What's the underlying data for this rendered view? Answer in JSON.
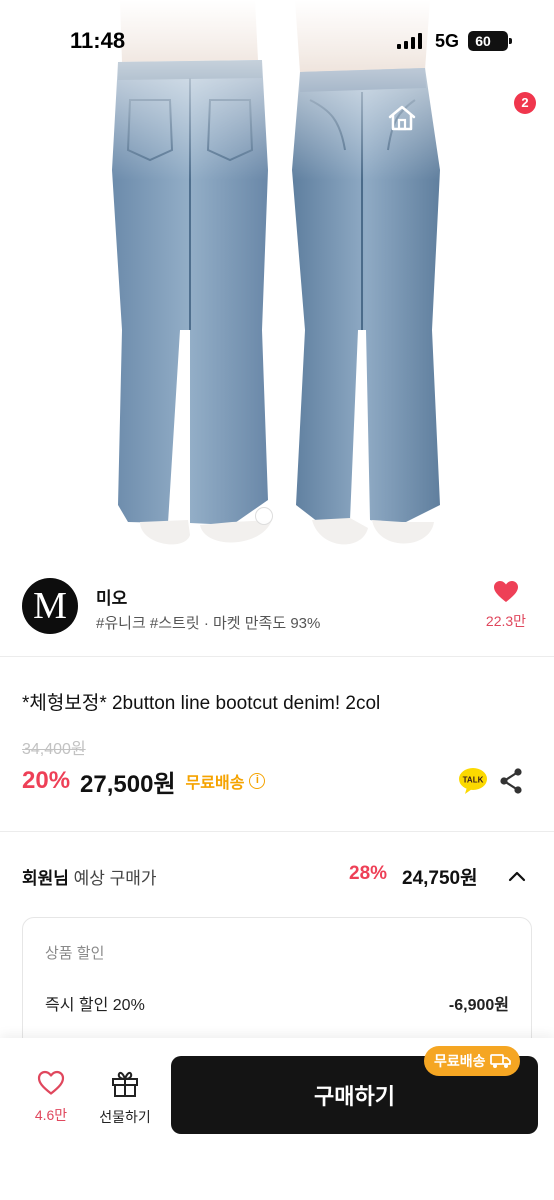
{
  "status_bar": {
    "time": "11:48",
    "network": "5G",
    "battery": "60"
  },
  "nav": {
    "cart_count": "2"
  },
  "seller": {
    "logo_letter": "M",
    "name": "미오",
    "tags": "#유니크 #스트릿 · 마켓 만족도 93%",
    "likes": "22.3만"
  },
  "product": {
    "title": "*체형보정* 2button line bootcut denim! 2col",
    "original_price": "34,400원",
    "discount_rate": "20%",
    "sale_price": "27,500원",
    "free_shipping": "무료배송",
    "info_icon": "i"
  },
  "member": {
    "label_bold": "회원님",
    "label_rest": " 예상 구매가",
    "rate": "28%",
    "price": "24,750원"
  },
  "discount_box": {
    "heading": "상품 할인",
    "item_label": "즉시 할인 20%",
    "item_value": "-6,900원"
  },
  "bottom_bar": {
    "wish_count": "4.6만",
    "gift_label": "선물하기",
    "buy_label": "구매하기",
    "ship_badge": "무료배송"
  },
  "colors": {
    "accent": "#ee4057",
    "shipping": "#f5a300",
    "buy_button": "#141414"
  }
}
